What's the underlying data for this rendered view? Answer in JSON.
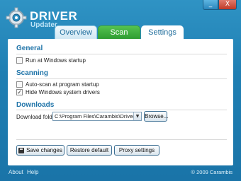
{
  "app": {
    "logo_line1": "DRIVER",
    "logo_line2": "Updater"
  },
  "window_buttons": {
    "minimize": "_",
    "close": "X"
  },
  "tabs": [
    {
      "label": "Overview",
      "color": "#e6f3fa"
    },
    {
      "label": "Scan",
      "color": "#3daa3f"
    },
    {
      "label": "Settings",
      "color": "#ffffff"
    }
  ],
  "general": {
    "title": "General",
    "run_at_startup": {
      "label": "Run at Windows startup",
      "checked": false
    }
  },
  "scanning": {
    "title": "Scanning",
    "auto_scan": {
      "label": "Auto-scan at program startup",
      "checked": false
    },
    "hide_system": {
      "label": "Hide Windows system drivers",
      "checked": true
    }
  },
  "downloads": {
    "title": "Downloads",
    "folder_label": "Download folder:",
    "folder_value": "C:\\Program Files\\Carambis\\Driver Upda",
    "browse_label": "Browse..."
  },
  "actions": {
    "save_label": "Save changes",
    "restore_label": "Restore default",
    "proxy_label": "Proxy settings"
  },
  "footer": {
    "about": "About",
    "help": "Help",
    "copyright": "© 2009 Carambis"
  },
  "colors": {
    "accent": "#1e73a8",
    "background": "#1f7fb3",
    "scan_tab": "#3daa3f"
  }
}
